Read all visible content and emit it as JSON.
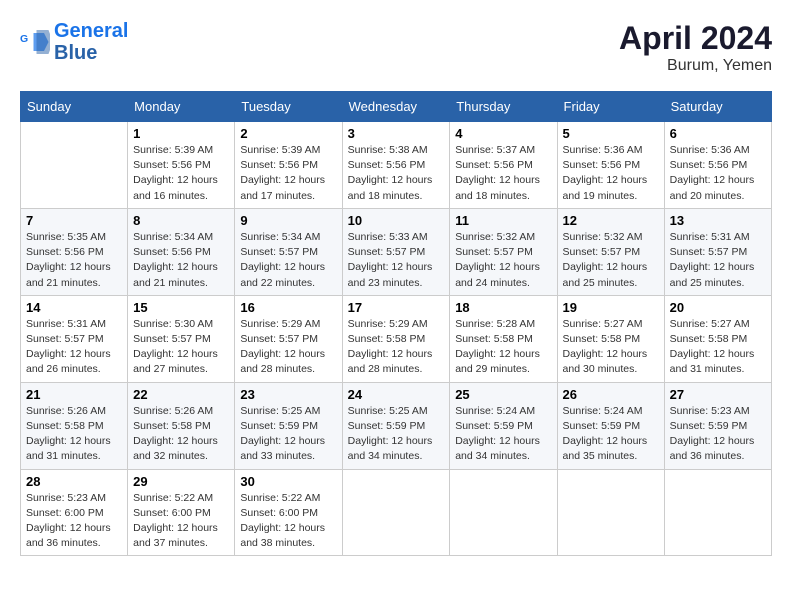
{
  "header": {
    "logo_line1": "General",
    "logo_line2": "Blue",
    "month_title": "April 2024",
    "location": "Burum, Yemen"
  },
  "weekdays": [
    "Sunday",
    "Monday",
    "Tuesday",
    "Wednesday",
    "Thursday",
    "Friday",
    "Saturday"
  ],
  "weeks": [
    [
      {
        "day": null
      },
      {
        "day": 1,
        "sunrise": "5:39 AM",
        "sunset": "5:56 PM",
        "daylight": "12 hours and 16 minutes."
      },
      {
        "day": 2,
        "sunrise": "5:39 AM",
        "sunset": "5:56 PM",
        "daylight": "12 hours and 17 minutes."
      },
      {
        "day": 3,
        "sunrise": "5:38 AM",
        "sunset": "5:56 PM",
        "daylight": "12 hours and 18 minutes."
      },
      {
        "day": 4,
        "sunrise": "5:37 AM",
        "sunset": "5:56 PM",
        "daylight": "12 hours and 18 minutes."
      },
      {
        "day": 5,
        "sunrise": "5:36 AM",
        "sunset": "5:56 PM",
        "daylight": "12 hours and 19 minutes."
      },
      {
        "day": 6,
        "sunrise": "5:36 AM",
        "sunset": "5:56 PM",
        "daylight": "12 hours and 20 minutes."
      }
    ],
    [
      {
        "day": 7,
        "sunrise": "5:35 AM",
        "sunset": "5:56 PM",
        "daylight": "12 hours and 21 minutes."
      },
      {
        "day": 8,
        "sunrise": "5:34 AM",
        "sunset": "5:56 PM",
        "daylight": "12 hours and 21 minutes."
      },
      {
        "day": 9,
        "sunrise": "5:34 AM",
        "sunset": "5:57 PM",
        "daylight": "12 hours and 22 minutes."
      },
      {
        "day": 10,
        "sunrise": "5:33 AM",
        "sunset": "5:57 PM",
        "daylight": "12 hours and 23 minutes."
      },
      {
        "day": 11,
        "sunrise": "5:32 AM",
        "sunset": "5:57 PM",
        "daylight": "12 hours and 24 minutes."
      },
      {
        "day": 12,
        "sunrise": "5:32 AM",
        "sunset": "5:57 PM",
        "daylight": "12 hours and 25 minutes."
      },
      {
        "day": 13,
        "sunrise": "5:31 AM",
        "sunset": "5:57 PM",
        "daylight": "12 hours and 25 minutes."
      }
    ],
    [
      {
        "day": 14,
        "sunrise": "5:31 AM",
        "sunset": "5:57 PM",
        "daylight": "12 hours and 26 minutes."
      },
      {
        "day": 15,
        "sunrise": "5:30 AM",
        "sunset": "5:57 PM",
        "daylight": "12 hours and 27 minutes."
      },
      {
        "day": 16,
        "sunrise": "5:29 AM",
        "sunset": "5:57 PM",
        "daylight": "12 hours and 28 minutes."
      },
      {
        "day": 17,
        "sunrise": "5:29 AM",
        "sunset": "5:58 PM",
        "daylight": "12 hours and 28 minutes."
      },
      {
        "day": 18,
        "sunrise": "5:28 AM",
        "sunset": "5:58 PM",
        "daylight": "12 hours and 29 minutes."
      },
      {
        "day": 19,
        "sunrise": "5:27 AM",
        "sunset": "5:58 PM",
        "daylight": "12 hours and 30 minutes."
      },
      {
        "day": 20,
        "sunrise": "5:27 AM",
        "sunset": "5:58 PM",
        "daylight": "12 hours and 31 minutes."
      }
    ],
    [
      {
        "day": 21,
        "sunrise": "5:26 AM",
        "sunset": "5:58 PM",
        "daylight": "12 hours and 31 minutes."
      },
      {
        "day": 22,
        "sunrise": "5:26 AM",
        "sunset": "5:58 PM",
        "daylight": "12 hours and 32 minutes."
      },
      {
        "day": 23,
        "sunrise": "5:25 AM",
        "sunset": "5:59 PM",
        "daylight": "12 hours and 33 minutes."
      },
      {
        "day": 24,
        "sunrise": "5:25 AM",
        "sunset": "5:59 PM",
        "daylight": "12 hours and 34 minutes."
      },
      {
        "day": 25,
        "sunrise": "5:24 AM",
        "sunset": "5:59 PM",
        "daylight": "12 hours and 34 minutes."
      },
      {
        "day": 26,
        "sunrise": "5:24 AM",
        "sunset": "5:59 PM",
        "daylight": "12 hours and 35 minutes."
      },
      {
        "day": 27,
        "sunrise": "5:23 AM",
        "sunset": "5:59 PM",
        "daylight": "12 hours and 36 minutes."
      }
    ],
    [
      {
        "day": 28,
        "sunrise": "5:23 AM",
        "sunset": "6:00 PM",
        "daylight": "12 hours and 36 minutes."
      },
      {
        "day": 29,
        "sunrise": "5:22 AM",
        "sunset": "6:00 PM",
        "daylight": "12 hours and 37 minutes."
      },
      {
        "day": 30,
        "sunrise": "5:22 AM",
        "sunset": "6:00 PM",
        "daylight": "12 hours and 38 minutes."
      },
      {
        "day": null
      },
      {
        "day": null
      },
      {
        "day": null
      },
      {
        "day": null
      }
    ]
  ],
  "labels": {
    "sunrise_prefix": "Sunrise: ",
    "sunset_prefix": "Sunset: ",
    "daylight_prefix": "Daylight: "
  }
}
